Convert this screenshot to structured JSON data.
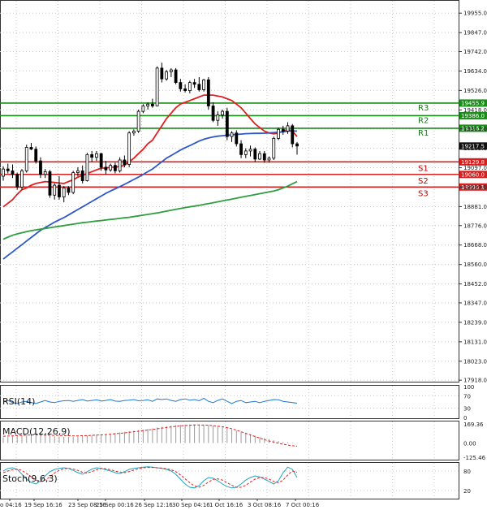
{
  "chart_data": {
    "type": "candlestick",
    "y_ticks": [
      "19955.0",
      "19847.0",
      "19742.0",
      "19634.0",
      "19526.0",
      "19418.0",
      "19313.0",
      "19205.0",
      "19097.0",
      "18989.0",
      "18881.0",
      "18776.0",
      "18668.0",
      "18560.0",
      "18452.0",
      "18347.0",
      "18239.0",
      "18131.0",
      "18023.0",
      "17918.0"
    ],
    "ylim": [
      17905,
      20010
    ],
    "x_ticks": [
      "o 04:16",
      "19 Sep 16:16",
      "23 Sep 08:16",
      "25 Sep 00:16",
      "26 Sep 12:16",
      "30 Sep 04:16",
      "1 Oct 16:16",
      "3 Oct 08:16",
      "7 Oct 00:16"
    ],
    "levels": [
      {
        "name": "R3",
        "value": 19455.9,
        "tag": "19455.9",
        "color": "#1a8c1a"
      },
      {
        "name": "R2",
        "value": 19386.0,
        "tag": "19386.0",
        "color": "#1a8c1a"
      },
      {
        "name": "R1",
        "value": 19316.2,
        "tag": "19316.2",
        "color": "#1a8c1a"
      },
      {
        "name": "S1",
        "value": 19129.8,
        "tag": "19129.8",
        "color": "#d42020"
      },
      {
        "name": "S2",
        "value": 19060.0,
        "tag": "19060.0",
        "color": "#d42020"
      },
      {
        "name": "S3",
        "value": 18990.1,
        "tag": "18990.1",
        "color": "#d42020"
      }
    ],
    "current_price": {
      "value": 19217.5,
      "tag": "19217.5"
    },
    "candles": [
      [
        19050,
        19105,
        19025,
        19090
      ],
      [
        19090,
        19120,
        19065,
        19080
      ],
      [
        19080,
        19115,
        19040,
        19060
      ],
      [
        19060,
        19070,
        18975,
        18990
      ],
      [
        18990,
        19090,
        18975,
        19080
      ],
      [
        19080,
        19225,
        19070,
        19210
      ],
      [
        19210,
        19235,
        19195,
        19200
      ],
      [
        19200,
        19215,
        19120,
        19135
      ],
      [
        19135,
        19155,
        19040,
        19060
      ],
      [
        19060,
        19090,
        19040,
        19075
      ],
      [
        19075,
        19085,
        18930,
        18945
      ],
      [
        18945,
        19010,
        18920,
        19000
      ],
      [
        19000,
        19050,
        18920,
        18935
      ],
      [
        18935,
        18995,
        18905,
        18985
      ],
      [
        18985,
        18995,
        18945,
        18960
      ],
      [
        18960,
        19080,
        18950,
        19070
      ],
      [
        19070,
        19100,
        19050,
        19080
      ],
      [
        19080,
        19110,
        19010,
        19025
      ],
      [
        19025,
        19180,
        19020,
        19170
      ],
      [
        19170,
        19190,
        19130,
        19155
      ],
      [
        19155,
        19190,
        19135,
        19175
      ],
      [
        19175,
        19180,
        19080,
        19100
      ],
      [
        19100,
        19135,
        19060,
        19085
      ],
      [
        19085,
        19120,
        19075,
        19110
      ],
      [
        19110,
        19125,
        19065,
        19080
      ],
      [
        19080,
        19155,
        19070,
        19140
      ],
      [
        19140,
        19165,
        19100,
        19115
      ],
      [
        19115,
        19300,
        19100,
        19290
      ],
      [
        19290,
        19310,
        19275,
        19300
      ],
      [
        19300,
        19420,
        19290,
        19410
      ],
      [
        19410,
        19450,
        19400,
        19440
      ],
      [
        19440,
        19460,
        19420,
        19450
      ],
      [
        19450,
        19480,
        19430,
        19440
      ],
      [
        19440,
        19660,
        19440,
        19650
      ],
      [
        19650,
        19680,
        19570,
        19590
      ],
      [
        19590,
        19640,
        19580,
        19630
      ],
      [
        19630,
        19650,
        19600,
        19640
      ],
      [
        19640,
        19650,
        19560,
        19570
      ],
      [
        19570,
        19590,
        19520,
        19535
      ],
      [
        19535,
        19560,
        19515,
        19525
      ],
      [
        19525,
        19580,
        19510,
        19570
      ],
      [
        19570,
        19590,
        19540,
        19560
      ],
      [
        19560,
        19600,
        19520,
        19530
      ],
      [
        19530,
        19590,
        19520,
        19585
      ],
      [
        19585,
        19600,
        19420,
        19440
      ],
      [
        19440,
        19460,
        19350,
        19360
      ],
      [
        19360,
        19410,
        19330,
        19390
      ],
      [
        19390,
        19420,
        19370,
        19410
      ],
      [
        19410,
        19430,
        19250,
        19270
      ],
      [
        19270,
        19300,
        19240,
        19290
      ],
      [
        19290,
        19305,
        19215,
        19230
      ],
      [
        19230,
        19250,
        19150,
        19170
      ],
      [
        19170,
        19205,
        19150,
        19190
      ],
      [
        19190,
        19220,
        19160,
        19200
      ],
      [
        19200,
        19210,
        19130,
        19145
      ],
      [
        19145,
        19190,
        19140,
        19175
      ],
      [
        19175,
        19190,
        19125,
        19140
      ],
      [
        19140,
        19160,
        19125,
        19150
      ],
      [
        19150,
        19270,
        19140,
        19260
      ],
      [
        19260,
        19320,
        19250,
        19310
      ],
      [
        19310,
        19330,
        19280,
        19300
      ],
      [
        19300,
        19350,
        19285,
        19330
      ],
      [
        19330,
        19340,
        19210,
        19230
      ],
      [
        19230,
        19240,
        19170,
        19217.5
      ]
    ],
    "series": [
      {
        "name": "ma_red",
        "color": "#e02020",
        "values": [
          18880,
          18900,
          18920,
          18950,
          18975,
          18985,
          19000,
          19010,
          19015,
          19020,
          19018,
          19015,
          19012,
          19010,
          19020,
          19030,
          19045,
          19055,
          19065,
          19075,
          19085,
          19095,
          19095,
          19100,
          19100,
          19105,
          19110,
          19130,
          19150,
          19175,
          19200,
          19230,
          19250,
          19290,
          19330,
          19370,
          19400,
          19430,
          19450,
          19460,
          19470,
          19480,
          19490,
          19500,
          19500,
          19500,
          19495,
          19490,
          19480,
          19470,
          19450,
          19430,
          19400,
          19370,
          19340,
          19320,
          19300,
          19290,
          19285,
          19290,
          19300,
          19310,
          19300,
          19270
        ]
      },
      {
        "name": "ma_blue",
        "color": "#2f58c9",
        "values": [
          18590,
          18610,
          18630,
          18650,
          18670,
          18690,
          18710,
          18730,
          18750,
          18765,
          18780,
          18795,
          18808,
          18820,
          18835,
          18850,
          18865,
          18880,
          18895,
          18910,
          18925,
          18940,
          18955,
          18968,
          18980,
          18992,
          19005,
          19018,
          19032,
          19045,
          19060,
          19075,
          19090,
          19110,
          19130,
          19150,
          19165,
          19180,
          19195,
          19208,
          19220,
          19232,
          19245,
          19255,
          19262,
          19268,
          19272,
          19275,
          19277,
          19280,
          19282,
          19284,
          19286,
          19287,
          19288,
          19288,
          19289,
          19290,
          19292,
          19294,
          19296,
          19300,
          19302,
          19300
        ]
      },
      {
        "name": "ma_green",
        "color": "#2e9e3e",
        "values": [
          18700,
          18712,
          18722,
          18730,
          18736,
          18742,
          18748,
          18752,
          18756,
          18760,
          18764,
          18768,
          18772,
          18776,
          18780,
          18784,
          18788,
          18792,
          18795,
          18798,
          18801,
          18804,
          18807,
          18810,
          18813,
          18816,
          18819,
          18822,
          18826,
          18830,
          18834,
          18838,
          18842,
          18846,
          18851,
          18856,
          18861,
          18866,
          18871,
          18876,
          18880,
          18884,
          18888,
          18893,
          18898,
          18903,
          18908,
          18913,
          18918,
          18923,
          18928,
          18933,
          18938,
          18943,
          18948,
          18953,
          18958,
          18963,
          18968,
          18975,
          18985,
          18995,
          19008,
          19020
        ]
      }
    ],
    "rsi": {
      "label": "RSI(14)",
      "ticks": [
        "100",
        "70",
        "30",
        "0"
      ],
      "ylim": [
        0,
        100
      ],
      "values": [
        52,
        55,
        48,
        45,
        50,
        52,
        48,
        45,
        50,
        55,
        50,
        48,
        52,
        54,
        55,
        52,
        55,
        58,
        53,
        55,
        57,
        53,
        55,
        58,
        53,
        52,
        55,
        56,
        58,
        54,
        55,
        57,
        52,
        60,
        58,
        60,
        55,
        52,
        58,
        60,
        56,
        58,
        54,
        62,
        52,
        48,
        55,
        60,
        52,
        45,
        52,
        55,
        48,
        50,
        52,
        48,
        52,
        55,
        58,
        57,
        52,
        50,
        48,
        46
      ]
    },
    "macd": {
      "label": "MACD(12,26,9)",
      "ticks": [
        "169.36",
        "0.00",
        "-125.46"
      ],
      "ylim": [
        -125.46,
        169.36
      ],
      "hist": [
        50,
        55,
        60,
        62,
        66,
        70,
        72,
        70,
        67,
        65,
        62,
        60,
        58,
        56,
        55,
        55,
        58,
        62,
        66,
        70,
        74,
        78,
        80,
        85,
        90,
        95,
        100,
        105,
        110,
        115,
        120,
        125,
        130,
        138,
        145,
        150,
        155,
        160,
        162,
        164,
        165,
        165,
        164,
        162,
        160,
        155,
        148,
        140,
        130,
        120,
        110,
        100,
        88,
        78,
        65,
        55,
        45,
        35,
        25,
        18,
        12,
        8,
        5,
        2
      ],
      "signal": [
        60,
        62,
        64,
        66,
        68,
        70,
        72,
        72,
        71,
        70,
        69,
        68,
        67,
        66,
        65,
        64,
        64,
        65,
        66,
        68,
        70,
        72,
        75,
        78,
        82,
        86,
        90,
        95,
        100,
        105,
        110,
        115,
        120,
        126,
        132,
        138,
        143,
        148,
        152,
        155,
        158,
        160,
        160,
        159,
        157,
        154,
        150,
        144,
        136,
        126,
        114,
        100,
        86,
        72,
        58,
        44,
        30,
        18,
        8,
        -2,
        -10,
        -18,
        -24,
        -28
      ]
    },
    "stoch": {
      "label": "Stoch(9,6,3)",
      "ticks": [
        "80",
        "20"
      ],
      "ylim": [
        0,
        100
      ],
      "k": [
        80,
        88,
        90,
        85,
        70,
        55,
        45,
        40,
        50,
        65,
        78,
        85,
        88,
        90,
        88,
        82,
        75,
        70,
        78,
        86,
        90,
        88,
        84,
        80,
        75,
        72,
        78,
        85,
        88,
        90,
        92,
        93,
        92,
        90,
        88,
        85,
        80,
        70,
        55,
        40,
        30,
        28,
        35,
        50,
        60,
        58,
        50,
        40,
        32,
        28,
        30,
        40,
        52,
        60,
        65,
        62,
        55,
        48,
        40,
        50,
        75,
        92,
        85,
        60
      ],
      "d": [
        75,
        80,
        84,
        86,
        82,
        72,
        62,
        52,
        48,
        52,
        62,
        74,
        82,
        87,
        88,
        86,
        82,
        76,
        74,
        78,
        84,
        88,
        87,
        84,
        80,
        76,
        75,
        78,
        83,
        87,
        90,
        91,
        91,
        90,
        89,
        87,
        84,
        78,
        68,
        56,
        44,
        34,
        30,
        36,
        46,
        54,
        56,
        52,
        44,
        36,
        30,
        30,
        36,
        46,
        55,
        60,
        60,
        55,
        48,
        44,
        52,
        68,
        80,
        76
      ]
    }
  }
}
